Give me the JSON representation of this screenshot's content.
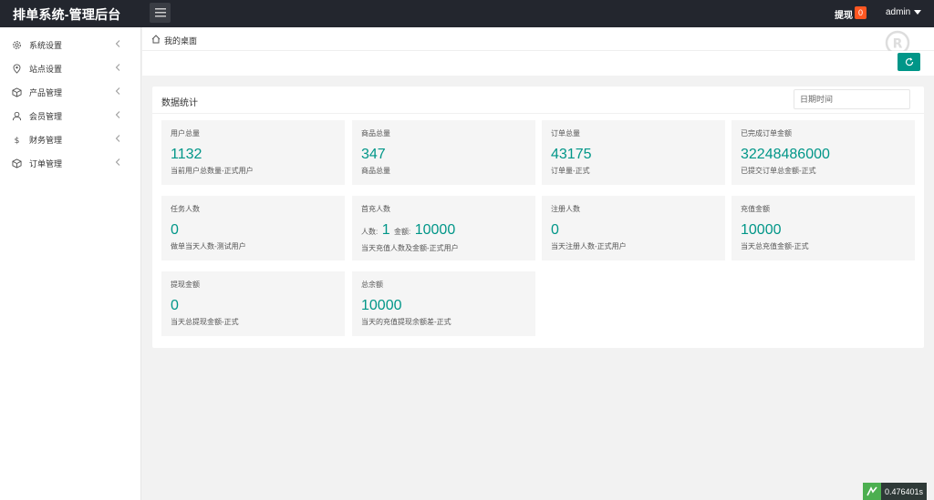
{
  "app": {
    "title": "排单系统-管理后台",
    "withdraw_label": "提现",
    "withdraw_count": "0",
    "user_name": "admin"
  },
  "sidebar": {
    "items": [
      {
        "label": "系统设置",
        "icon": "gear-icon"
      },
      {
        "label": "站点设置",
        "icon": "location-icon"
      },
      {
        "label": "产品管理",
        "icon": "cube-icon"
      },
      {
        "label": "会员管理",
        "icon": "user-icon"
      },
      {
        "label": "财务管理",
        "icon": "dollar-icon"
      },
      {
        "label": "订单管理",
        "icon": "cube-icon"
      }
    ]
  },
  "breadcrumb": {
    "label": "我的桌面"
  },
  "panel": {
    "title": "数据统计",
    "date_placeholder": "日期时间"
  },
  "stats": [
    {
      "label": "用户总量",
      "value": "1132",
      "desc": "当前用户总数量-正式用户"
    },
    {
      "label": "商品总量",
      "value": "347",
      "desc": "商品总量"
    },
    {
      "label": "订单总量",
      "value": "43175",
      "desc": "订单量-正式"
    },
    {
      "label": "已完成订单金额",
      "value": "32248486000",
      "desc": "已提交订单总金额-正式"
    },
    {
      "label": "任务人数",
      "value": "0",
      "desc": "做单当天人数-测试用户"
    },
    {
      "label": "首充人数",
      "count_prefix": "人数:",
      "count": "1",
      "amount_prefix": "金额:",
      "amount": "10000",
      "desc": "当天充值人数及金额-正式用户"
    },
    {
      "label": "注册人数",
      "value": "0",
      "desc": "当天注册人数-正式用户"
    },
    {
      "label": "充值金额",
      "value": "10000",
      "desc": "当天总充值金额-正式"
    },
    {
      "label": "提现金额",
      "value": "0",
      "desc": "当天总提现金额-正式"
    },
    {
      "label": "总余额",
      "value": "10000",
      "desc": "当天的充值提现余额差-正式"
    }
  ],
  "footer": {
    "load_time": "0.476401s"
  },
  "colors": {
    "accent": "#009688",
    "header": "#23262e",
    "badge": "#ff5722"
  }
}
